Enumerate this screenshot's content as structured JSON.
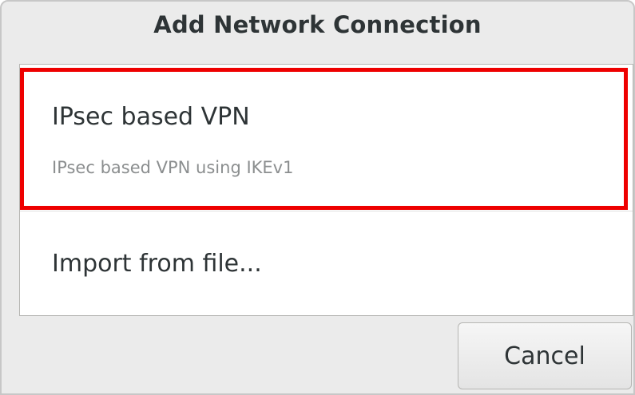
{
  "dialog": {
    "title": "Add Network Connection"
  },
  "options": [
    {
      "title": "IPsec based VPN",
      "subtitle": "IPsec based VPN using IKEv1",
      "highlighted": true
    },
    {
      "title": "Import from file..."
    }
  ],
  "buttons": {
    "cancel_label": "Cancel"
  },
  "colors": {
    "highlight": "#ee0000",
    "title_text": "#2e3436",
    "subtitle_text": "#8b8e8f",
    "dialog_background": "#ebebeb"
  }
}
